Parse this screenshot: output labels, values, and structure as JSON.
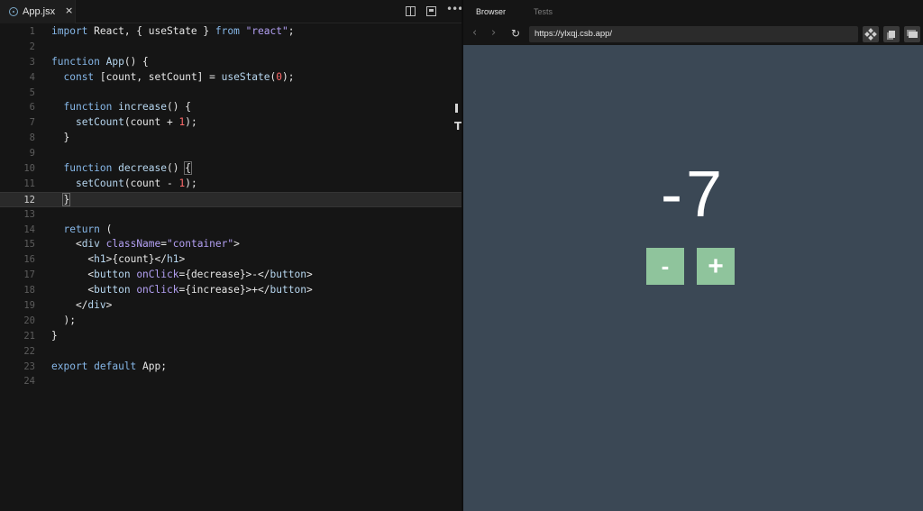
{
  "editor": {
    "tab": {
      "filename": "App.jsx",
      "close_glyph": "×"
    },
    "toolbar": [
      "split-editor-icon",
      "open-preview-icon",
      "more-icon"
    ],
    "lines": [
      {
        "n": "1",
        "tokens": [
          [
            "k",
            "import "
          ],
          [
            "p",
            "React, { useState } "
          ],
          [
            "k",
            "from "
          ],
          [
            "s",
            "\"react\""
          ],
          [
            "p",
            ";"
          ]
        ]
      },
      {
        "n": "2",
        "tokens": []
      },
      {
        "n": "3",
        "tokens": [
          [
            "k",
            "function "
          ],
          [
            "t",
            "App"
          ],
          [
            "p",
            "() {"
          ]
        ]
      },
      {
        "n": "4",
        "tokens": [
          [
            "p",
            "  "
          ],
          [
            "k",
            "const "
          ],
          [
            "p",
            "[count, setCount] = "
          ],
          [
            "t",
            "useState"
          ],
          [
            "p",
            "("
          ],
          [
            "n",
            "0"
          ],
          [
            "p",
            ");"
          ]
        ]
      },
      {
        "n": "5",
        "tokens": []
      },
      {
        "n": "6",
        "tokens": [
          [
            "p",
            "  "
          ],
          [
            "k",
            "function "
          ],
          [
            "t",
            "increase"
          ],
          [
            "p",
            "() {"
          ]
        ]
      },
      {
        "n": "7",
        "tokens": [
          [
            "p",
            "    "
          ],
          [
            "t",
            "setCount"
          ],
          [
            "p",
            "(count + "
          ],
          [
            "n",
            "1"
          ],
          [
            "p",
            ");"
          ]
        ]
      },
      {
        "n": "8",
        "tokens": [
          [
            "p",
            "  }"
          ]
        ]
      },
      {
        "n": "9",
        "tokens": []
      },
      {
        "n": "10",
        "tokens": [
          [
            "p",
            "  "
          ],
          [
            "k",
            "function "
          ],
          [
            "t",
            "decrease"
          ],
          [
            "p",
            "() "
          ],
          [
            "hl",
            "{"
          ]
        ]
      },
      {
        "n": "11",
        "tokens": [
          [
            "p",
            "    "
          ],
          [
            "t",
            "setCount"
          ],
          [
            "p",
            "(count - "
          ],
          [
            "n",
            "1"
          ],
          [
            "p",
            ");"
          ]
        ]
      },
      {
        "n": "12",
        "tokens": [
          [
            "p",
            "  "
          ],
          [
            "hl",
            "}"
          ]
        ]
      },
      {
        "n": "13",
        "tokens": []
      },
      {
        "n": "14",
        "tokens": [
          [
            "p",
            "  "
          ],
          [
            "k",
            "return "
          ],
          [
            "p",
            "("
          ]
        ]
      },
      {
        "n": "15",
        "tokens": [
          [
            "p",
            "    <"
          ],
          [
            "t",
            "div "
          ],
          [
            "s",
            "className"
          ],
          [
            "p",
            "="
          ],
          [
            "s",
            "\"container\""
          ],
          [
            "p",
            ">"
          ]
        ]
      },
      {
        "n": "16",
        "tokens": [
          [
            "p",
            "      <"
          ],
          [
            "t",
            "h1"
          ],
          [
            "p",
            ">{count}</"
          ],
          [
            "t",
            "h1"
          ],
          [
            "p",
            ">"
          ]
        ]
      },
      {
        "n": "17",
        "tokens": [
          [
            "p",
            "      <"
          ],
          [
            "t",
            "button "
          ],
          [
            "s",
            "onClick"
          ],
          [
            "p",
            "={decrease}>-</"
          ],
          [
            "t",
            "button"
          ],
          [
            "p",
            ">"
          ]
        ]
      },
      {
        "n": "18",
        "tokens": [
          [
            "p",
            "      <"
          ],
          [
            "t",
            "button "
          ],
          [
            "s",
            "onClick"
          ],
          [
            "p",
            "={increase}>+</"
          ],
          [
            "t",
            "button"
          ],
          [
            "p",
            ">"
          ]
        ]
      },
      {
        "n": "19",
        "tokens": [
          [
            "p",
            "    </"
          ],
          [
            "t",
            "div"
          ],
          [
            "p",
            ">"
          ]
        ]
      },
      {
        "n": "20",
        "tokens": [
          [
            "p",
            "  );"
          ]
        ]
      },
      {
        "n": "21",
        "tokens": [
          [
            "p",
            "}"
          ]
        ]
      },
      {
        "n": "22",
        "tokens": []
      },
      {
        "n": "23",
        "tokens": [
          [
            "k",
            "export default "
          ],
          [
            "p",
            "App;"
          ]
        ]
      },
      {
        "n": "24",
        "tokens": []
      }
    ],
    "active_line": "12",
    "scroll_markers": [
      "I",
      "T"
    ]
  },
  "browser": {
    "tabs": {
      "browser": "Browser",
      "tests": "Tests"
    },
    "nav": {
      "back": "‹",
      "forward": "›",
      "reload": "↻"
    },
    "url": "https://ylxqj.csb.app/",
    "app": {
      "count": "-7",
      "decrease_label": "-",
      "increase_label": "+"
    }
  },
  "colors": {
    "keyword": "#86b7e8",
    "string": "#b3a0f3",
    "number": "#ff6b6b",
    "preview_bg": "#3b4855",
    "button_bg": "#8fc49c"
  }
}
